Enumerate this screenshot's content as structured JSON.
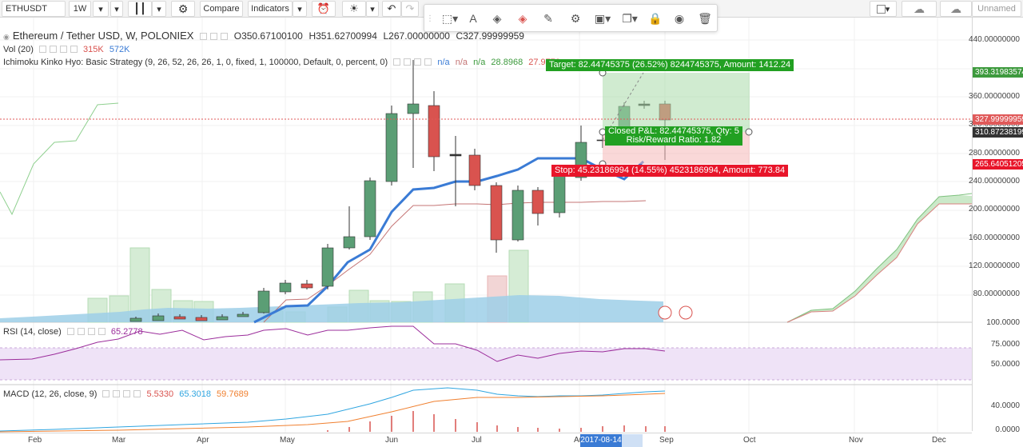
{
  "toolbar": {
    "symbol": "ETHUSDT",
    "interval": "1W",
    "compare_label": "Compare",
    "indicators_label": "Indicators",
    "layout_name": "Unnamed"
  },
  "main_legend": {
    "title": "Ethereum / Tether USD, W, POLONIEX",
    "open": "O350.67100100",
    "high": "H351.62700994",
    "low": "L267.00000000",
    "close": "C327.99999959"
  },
  "vol_legend": {
    "name": "Vol (20)",
    "v1": "315K",
    "v2": "572K"
  },
  "ichimoku_legend": {
    "name": "Ichimoku Kinko Hyo: Basic Strategy (9, 26, 52, 26, 26, 1, 0, fixed, 1, 100000, Default, 0, percent, 0)",
    "v1": "n/a",
    "v2": "n/a",
    "v3": "n/a",
    "v4": "28.8968",
    "v5": "27.9770"
  },
  "rsi_legend": {
    "name": "RSI (14, close)",
    "value": "65.2778"
  },
  "macd_legend": {
    "name": "MACD (12, 26, close, 9)",
    "v1": "5.5330",
    "v2": "65.3018",
    "v3": "59.7689"
  },
  "position": {
    "target": "Target: 82.44745375 (26.52%) 8244745375, Amount: 1412.24",
    "closed": "Closed P&L: 82.44745375, Qty: 5",
    "ratio": "Risk/Reward Ratio: 1.82",
    "stop": "Stop: 45.23186994 (14.55%) 4523186994, Amount: 773.84"
  },
  "price_axis": {
    "labels": [
      "440.00000000",
      "400.00000000",
      "360.00000000",
      "320.00000000",
      "280.00000000",
      "240.00000000",
      "200.00000000",
      "160.00000000",
      "120.00000000",
      "80.00000000"
    ],
    "tag_target": "393.31983574",
    "tag_last": "327.99999959",
    "tag_entry": "310.87238199",
    "tag_stop": "265.64051205",
    "tag_colors": {
      "target": "#3d9a3d",
      "last": "#e05a5a",
      "entry": "#333333",
      "stop": "#e8152a"
    }
  },
  "rsi_axis": {
    "labels": [
      "100.0000",
      "75.0000",
      "50.0000"
    ]
  },
  "macd_axis": {
    "labels": [
      "40.0000",
      "0.0000"
    ]
  },
  "time_axis": {
    "labels": [
      "Feb",
      "Mar",
      "Apr",
      "May",
      "Jun",
      "Jul",
      "Au",
      "Sep",
      "Oct",
      "Nov",
      "Dec"
    ],
    "highlight": "2017-08-14"
  },
  "colors": {
    "up": "#5b9e75",
    "down": "#d9534f",
    "kijun": "#3a7bd5",
    "tenkan": "#c47474",
    "cloud": "#a3d9a3",
    "rsi": "#9b2c9b",
    "macd": "#2fa5e0",
    "signal": "#f08030"
  }
}
